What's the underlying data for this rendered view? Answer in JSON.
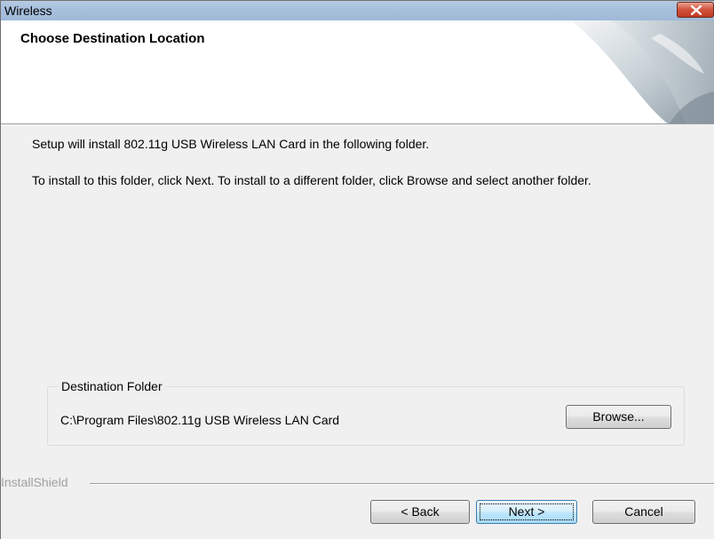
{
  "window": {
    "title": "Wireless"
  },
  "header": {
    "title": "Choose Destination Location"
  },
  "body": {
    "line1": "Setup will install 802.11g USB Wireless LAN Card in the following folder.",
    "line2": "To install to this folder, click Next. To install to a different folder, click Browse and select another folder."
  },
  "destination": {
    "legend": "Destination Folder",
    "path": "C:\\Program Files\\802.11g USB Wireless LAN Card",
    "browse_label": "Browse..."
  },
  "brand": {
    "label": "InstallShield"
  },
  "buttons": {
    "back": "< Back",
    "next": "Next >",
    "cancel": "Cancel"
  },
  "colors": {
    "close_button": "#c8452d",
    "dialog_background": "#f0f0f0",
    "titlebar": "#a7bfdc"
  },
  "icons": {
    "close": "close-icon",
    "header_graphic": "page-curl-graphic"
  }
}
